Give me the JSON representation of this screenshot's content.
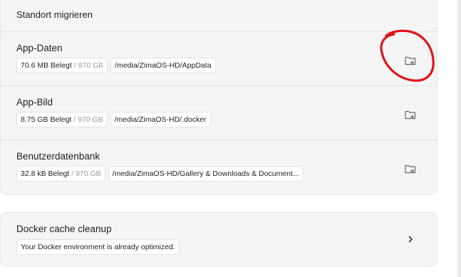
{
  "storage": {
    "header": "Standort migrieren",
    "rows": [
      {
        "title": "App-Daten",
        "used": "70.6 MB Belegt",
        "total": " / 970 GB",
        "path": "/media/ZimaOS-HD/AppData",
        "icon": "folder-move-icon"
      },
      {
        "title": "App-Bild",
        "used": "8.75 GB Belegt",
        "total": " / 970 GB",
        "path": "/media/ZimaOS-HD/.docker",
        "icon": "folder-move-icon"
      },
      {
        "title": "Benutzerdatenbank",
        "used": "32.8 kB Belegt",
        "total": " / 970 GB",
        "path": "/media/ZimaOS-HD/Gallery & Downloads & Document...",
        "icon": "folder-move-icon"
      }
    ]
  },
  "docker": {
    "title": "Docker cache cleanup",
    "status": "Your Docker environment is already optimized.",
    "icon": "chevron-right-icon"
  },
  "colors": {
    "card_bg": "#f5f5f5",
    "border": "#e4e4e4",
    "muted": "#9a9a9a",
    "annotation": "#e0141b"
  }
}
